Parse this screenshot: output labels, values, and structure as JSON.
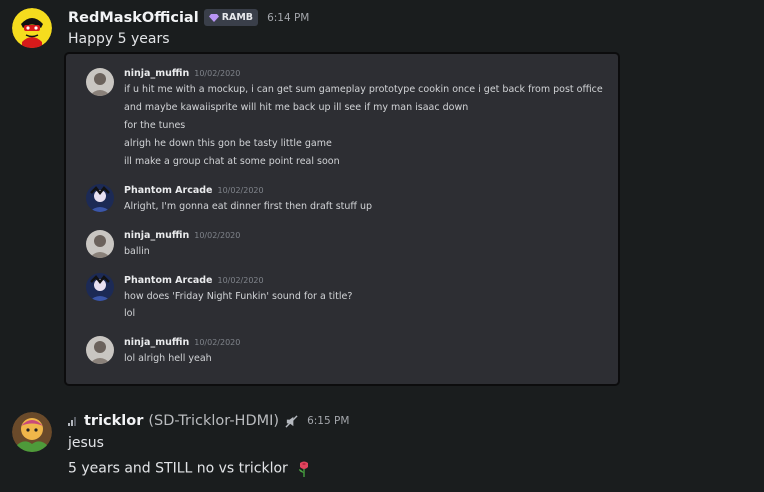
{
  "messages": [
    {
      "author": "RedMaskOfficial",
      "badge": "RAMB",
      "time": "6:14 PM",
      "lines": [
        "Happy 5 years"
      ]
    },
    {
      "author": "tricklor",
      "handle": "(SD-Tricklor-HDMI)",
      "time": "6:15 PM",
      "lines": [
        "jesus",
        "5 years and STILL no vs tricklor"
      ]
    }
  ],
  "embed": {
    "groups": [
      {
        "author": "ninja_muffin",
        "date": "10/02/2020",
        "lines": [
          "if u hit me with a mockup, i can get sum gameplay prototype cookin once i get back from post office",
          "and maybe kawaiisprite will hit me back up ill see if my man isaac down",
          "for the tunes",
          "alrigh he down this gon be tasty little game",
          "ill make a group chat at some point real soon"
        ]
      },
      {
        "author": "Phantom Arcade",
        "date": "10/02/2020",
        "lines": [
          "Alright, I'm gonna eat dinner first then draft stuff up"
        ]
      },
      {
        "author": "ninja_muffin",
        "date": "10/02/2020",
        "lines": [
          "ballin"
        ]
      },
      {
        "author": "Phantom Arcade",
        "date": "10/02/2020",
        "lines": [
          "how does 'Friday Night Funkin' sound for a title?",
          "lol"
        ]
      },
      {
        "author": "ninja_muffin",
        "date": "10/02/2020",
        "lines": [
          "lol alrigh hell yeah"
        ]
      }
    ]
  },
  "colors": {
    "background": "#1a1d1e",
    "embed_background": "#2d2e33",
    "badge_gem": "#b995f5",
    "avatar_yellow": "#f5dc1e",
    "avatar_red": "#d61a1a"
  },
  "icons": [
    "signal-bars-icon",
    "muted-speaker-icon",
    "rose-emoji-icon",
    "gem-icon"
  ]
}
